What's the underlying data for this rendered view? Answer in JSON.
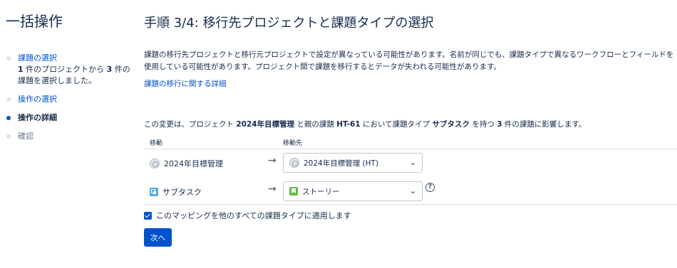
{
  "sidebar": {
    "heading": "一括操作",
    "steps": [
      {
        "label": "課題の選択",
        "desc_prefix": "1",
        "desc_mid": " 件のプロジェクトから ",
        "desc_count": "3",
        "desc_suffix": " 件の課題を選択しました。"
      },
      {
        "label": "操作の選択"
      },
      {
        "label": "操作の詳細"
      },
      {
        "label": "確認"
      }
    ]
  },
  "main": {
    "title": "手順 3/4: 移行先プロジェクトと課題タイプの選択",
    "intro": "課題の移行先プロジェクトと移行元プロジェクトで設定が異なっている可能性があります。名前が同じでも、課題タイプで異なるワークフローとフィールドを使用している可能性があります。プロジェクト間で課題を移行するとデータが失われる可能性があります。",
    "learn_more": "課題の移行に関する詳細",
    "impact": {
      "p1": "この変更は、プロジェクト ",
      "project": "2024年目標管理",
      "p2": " と親の課題 ",
      "parent": "HT-61",
      "p3": " において課題タイプ ",
      "type": "サブタスク",
      "p4": " を持つ ",
      "count": "3",
      "p5": " 件の課題に影響します。"
    },
    "table": {
      "col_from": "移動",
      "col_to": "移動先",
      "rows": [
        {
          "source": "2024年目標管理",
          "arrow": "→",
          "target": "2024年目標管理 (HT)",
          "source_icon": "project-avatar-icon",
          "target_icon": "project-avatar-icon"
        },
        {
          "source": "サブタスク",
          "arrow": "→",
          "target": "ストーリー",
          "source_icon": "subtask-icon",
          "target_icon": "story-icon"
        }
      ]
    },
    "help_glyph": "?",
    "chevron_glyph": "⌄",
    "apply_label": "このマッピングを他のすべての課題タイプに適用します",
    "apply_checked": true,
    "next_button": "次へ"
  }
}
